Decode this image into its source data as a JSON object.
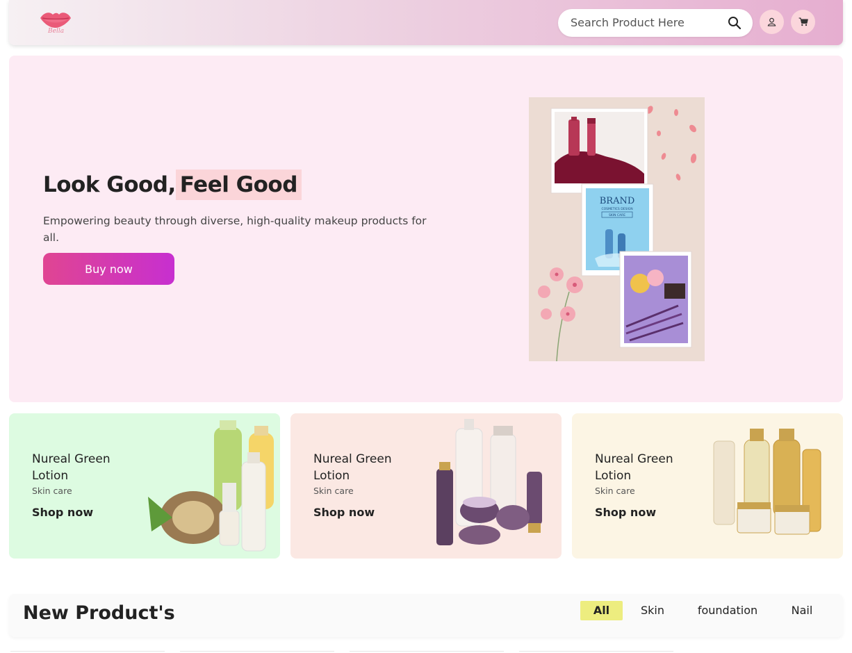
{
  "header": {
    "logo_text": "Bella",
    "search_placeholder": "Search Product Here",
    "icons": [
      "search-icon",
      "user-icon",
      "cart-icon"
    ]
  },
  "hero": {
    "title_part1": "Look Good,",
    "title_part2": "Feel Good",
    "subtitle": "Empowering beauty through diverse, high-quality makeup products for all.",
    "button_label": "Buy now",
    "collage_text": {
      "brand": "BRAND",
      "brand_sub": "COSMETICS DESIGN",
      "skin_care": "SKIN CARE"
    }
  },
  "promo_cards": [
    {
      "name": "Nureal Green Lotion",
      "category": "Skin care",
      "link": "Shop now",
      "bg": "#ddfbe1"
    },
    {
      "name": "Nureal Green Lotion",
      "category": "Skin care",
      "link": "Shop now",
      "bg": "#fbe8e3"
    },
    {
      "name": "Nureal Green Lotion",
      "category": "Skin care",
      "link": "Shop now",
      "bg": "#fcf5e4"
    }
  ],
  "new_products": {
    "title": "New Product's",
    "tabs": [
      "All",
      "Skin",
      "foundation",
      "Nail"
    ],
    "active_tab": "All"
  },
  "colors": {
    "accent_gradient_start": "#e04592",
    "accent_gradient_end": "#c72fd0",
    "hero_bg": "#fdebf4",
    "highlight": "#fbd5d9",
    "active_tab": "#eded7f"
  }
}
